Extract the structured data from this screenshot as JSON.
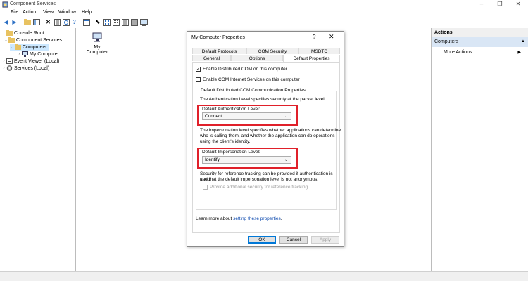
{
  "window": {
    "title": "Component Services",
    "controls": {
      "minimize": "–",
      "restore": "❐",
      "close": "✕"
    }
  },
  "menu": [
    "File",
    "Action",
    "View",
    "Window",
    "Help"
  ],
  "tree": {
    "items": [
      {
        "label": "Console Root",
        "expander": "",
        "icon": "folder-icon"
      },
      {
        "label": "Component Services",
        "expander": "⌄",
        "icon": "folder-icon"
      },
      {
        "label": "Computers",
        "expander": "⌄",
        "icon": "folder-icon",
        "selected": true
      },
      {
        "label": "My Computer",
        "expander": "›",
        "icon": "computer-icon"
      },
      {
        "label": "Event Viewer (Local)",
        "expander": "›",
        "icon": "event-viewer-icon"
      },
      {
        "label": "Services (Local)",
        "expander": "›",
        "icon": "services-icon"
      }
    ]
  },
  "content": {
    "item_label": "My Computer"
  },
  "actions": {
    "header": "Actions",
    "section": "Computers",
    "section_arrow": "▲",
    "more": "More Actions",
    "more_arrow": "▶"
  },
  "dialog": {
    "title": "My Computer Properties",
    "help": "?",
    "close": "✕",
    "tabs_row1": [
      "Default Protocols",
      "COM Security",
      "MSDTC"
    ],
    "tabs_row2": [
      "General",
      "Options",
      "Default Properties"
    ],
    "active_tab": "Default Properties",
    "enable_dcom": {
      "label": "Enable Distributed COM on this computer",
      "checked": true,
      "mark": "✓"
    },
    "enable_cis": {
      "label": "Enable COM Internet Services on this computer",
      "checked": false
    },
    "group_title": "Default Distributed COM Communication Properties",
    "auth_desc": "The Authentication Level specifies security at the packet level.",
    "auth_label": "Default Authentication Level:",
    "auth_value": "Connect",
    "imp_desc_1": "The impersonation level specifies whether applications can determine",
    "imp_desc_2": "who is calling them, and whether the application can do operations",
    "imp_desc_3": "using the client's identity.",
    "imp_label": "Default Impersonation Level:",
    "imp_value": "Identify",
    "ref_desc_1": "Security for reference tracking can be provided if authentication is used",
    "ref_desc_2": "and that the default impersonation level is not anonymous.",
    "ref_checkbox": {
      "label": "Provide additional security for reference tracking",
      "checked": false
    },
    "learn_more_prefix": "Learn more about ",
    "learn_more_link": "setting these properties",
    "learn_more_suffix": ".",
    "ok": "OK",
    "cancel": "Cancel",
    "apply": "Apply",
    "chevron": "⌄"
  },
  "colors": {
    "highlight": "#e0202a",
    "selection": "#cce8ff",
    "actions_section": "#d9e6f5",
    "link": "#0645ad"
  }
}
